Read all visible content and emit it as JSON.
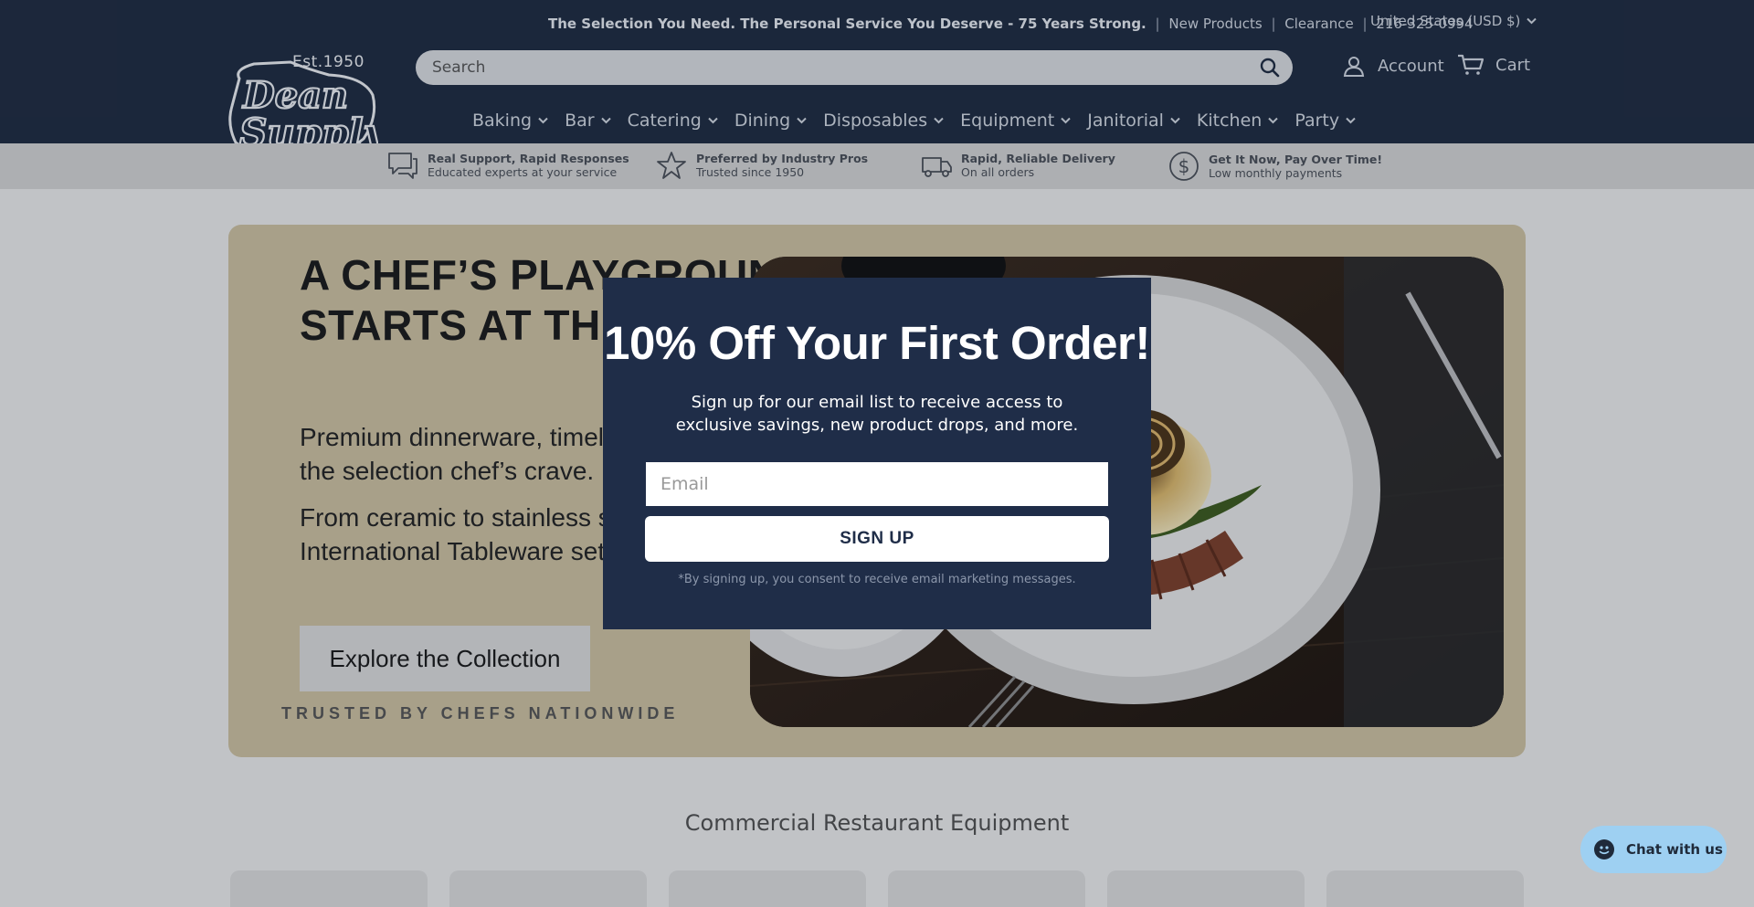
{
  "header": {
    "announcement_bold": "The Selection You Need. The Personal Service You Deserve - 75 Years Strong.",
    "announcement_links": [
      "New Products",
      "Clearance",
      "216-325-0994"
    ],
    "currency": "United States (USD $)",
    "logo_est": "Est.1950",
    "logo_text": "Dean Supply",
    "search_placeholder": "Search",
    "account_label": "Account",
    "cart_label": "Cart"
  },
  "nav": {
    "items": [
      "Baking",
      "Bar",
      "Catering",
      "Dining",
      "Disposables",
      "Equipment",
      "Janitorial",
      "Kitchen",
      "Party"
    ]
  },
  "features": [
    {
      "title": "Real Support, Rapid Responses",
      "subtitle": "Educated experts at your service",
      "icon": "chat-bubble-icon"
    },
    {
      "title": "Preferred by Industry Pros",
      "subtitle": "Trusted since 1950",
      "icon": "star-icon"
    },
    {
      "title": "Rapid, Reliable Delivery",
      "subtitle": "On all orders",
      "icon": "truck-icon"
    },
    {
      "title": "Get It Now, Pay Over Time!",
      "subtitle": "Low monthly payments",
      "icon": "dollar-icon"
    }
  ],
  "hero": {
    "title": "A CHEF’S PLAYGROUND STARTS AT THE TABLE",
    "description": "Premium dinnerware, timeless style, and the selection chef’s crave.",
    "description2": "From ceramic to stainless steel, International Tableware sets the standard.",
    "button_label": "Explore the Collection",
    "trusted": "TRUSTED BY CHEFS NATIONWIDE"
  },
  "section": {
    "title": "Commercial Restaurant Equipment"
  },
  "modal": {
    "title": "10% Off Your First Order!",
    "text": "Sign up for our email list to receive access to exclusive savings, new product drops, and more.",
    "email_placeholder": "Email",
    "button_label": "SIGN UP",
    "consent": "*By signing up, you consent to receive email marketing messages."
  },
  "chat": {
    "label": "Chat with us"
  },
  "colors": {
    "header_bg": "#1f2b40",
    "modal_bg": "#1f2d48",
    "hero_bg": "#cbbf9f",
    "chat_bg": "#9ed0f2"
  }
}
